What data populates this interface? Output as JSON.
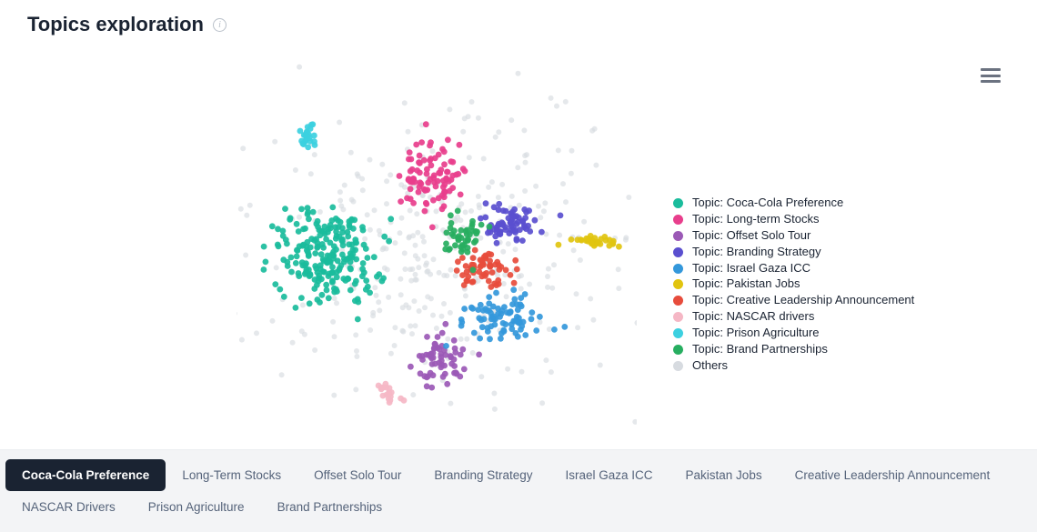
{
  "page": {
    "title": "Topics exploration"
  },
  "legend_prefix": "Topic: ",
  "legend_others": "Others",
  "topics": [
    {
      "key": "coca_cola_preference",
      "label": "Coca-Cola Preference",
      "color": "#1abc9c"
    },
    {
      "key": "long_term_stocks",
      "label": "Long-term Stocks",
      "color": "#e83e8c"
    },
    {
      "key": "offset_solo_tour",
      "label": "Offset Solo Tour",
      "color": "#9b59b6"
    },
    {
      "key": "branding_strategy",
      "label": "Branding Strategy",
      "color": "#5a4fcf"
    },
    {
      "key": "israel_gaza_icc",
      "label": "Israel Gaza ICC",
      "color": "#3498db"
    },
    {
      "key": "pakistan_jobs",
      "label": "Pakistan Jobs",
      "color": "#e1c40f"
    },
    {
      "key": "creative_leadership_announcement",
      "label": "Creative Leadership Announcement",
      "color": "#e74c3c"
    },
    {
      "key": "nascar_drivers",
      "label": "NASCAR drivers",
      "color": "#f5b7c5"
    },
    {
      "key": "prison_agriculture",
      "label": "Prison Agriculture",
      "color": "#3cd0e0"
    },
    {
      "key": "brand_partnerships",
      "label": "Brand Partnerships",
      "color": "#27ae60"
    }
  ],
  "others_color": "#d7dbe0",
  "tabs": [
    {
      "label": "Coca-Cola Preference",
      "active": true
    },
    {
      "label": "Long-Term Stocks",
      "active": false
    },
    {
      "label": "Offset Solo Tour",
      "active": false
    },
    {
      "label": "Branding Strategy",
      "active": false
    },
    {
      "label": "Israel Gaza ICC",
      "active": false
    },
    {
      "label": "Pakistan Jobs",
      "active": false
    },
    {
      "label": "Creative Leadership Announcement",
      "active": false
    },
    {
      "label": "NASCAR Drivers",
      "active": false
    },
    {
      "label": "Prison Agriculture",
      "active": false
    },
    {
      "label": "Brand Partnerships",
      "active": false
    }
  ],
  "chart_data": {
    "type": "scatter",
    "title": "Topics exploration",
    "xlabel": "",
    "ylabel": "",
    "xlim": [
      0,
      440
    ],
    "ylim": [
      0,
      400
    ],
    "note": "2-D embedding / projection scatter; axes are dimensionless (no ticks or grid shown). Coordinates are approximate pixel positions within the plotted region.",
    "clusters": [
      {
        "series": "others",
        "name": "Others",
        "center": [
          220,
          200
        ],
        "spread": [
          200,
          150
        ],
        "n": 350
      },
      {
        "series": "coca_cola_preference",
        "name": "Coca-Cola Preference",
        "center": [
          100,
          210
        ],
        "spread": [
          55,
          55
        ],
        "n": 220
      },
      {
        "series": "long_term_stocks",
        "name": "Long-term Stocks",
        "center": [
          215,
          125
        ],
        "spread": [
          35,
          40
        ],
        "n": 90
      },
      {
        "series": "offset_solo_tour",
        "name": "Offset Solo Tour",
        "center": [
          225,
          325
        ],
        "spread": [
          28,
          28
        ],
        "n": 60
      },
      {
        "series": "branding_strategy",
        "name": "Branding Strategy",
        "center": [
          300,
          175
        ],
        "spread": [
          30,
          20
        ],
        "n": 70
      },
      {
        "series": "israel_gaza_icc",
        "name": "Israel Gaza ICC",
        "center": [
          290,
          280
        ],
        "spread": [
          45,
          25
        ],
        "n": 80
      },
      {
        "series": "pakistan_jobs",
        "name": "Pakistan Jobs",
        "center": [
          395,
          195
        ],
        "spread": [
          30,
          6
        ],
        "n": 30
      },
      {
        "series": "creative_leadership_announcement",
        "name": "Creative Leadership Announcement",
        "center": [
          270,
          225
        ],
        "spread": [
          35,
          20
        ],
        "n": 60
      },
      {
        "series": "nascar_drivers",
        "name": "NASCAR drivers",
        "center": [
          165,
          360
        ],
        "spread": [
          12,
          12
        ],
        "n": 20
      },
      {
        "series": "prison_agriculture",
        "name": "Prison Agriculture",
        "center": [
          80,
          80
        ],
        "spread": [
          12,
          14
        ],
        "n": 25
      },
      {
        "series": "brand_partnerships",
        "name": "Brand Partnerships",
        "center": [
          250,
          190
        ],
        "spread": [
          22,
          22
        ],
        "n": 45
      }
    ]
  }
}
